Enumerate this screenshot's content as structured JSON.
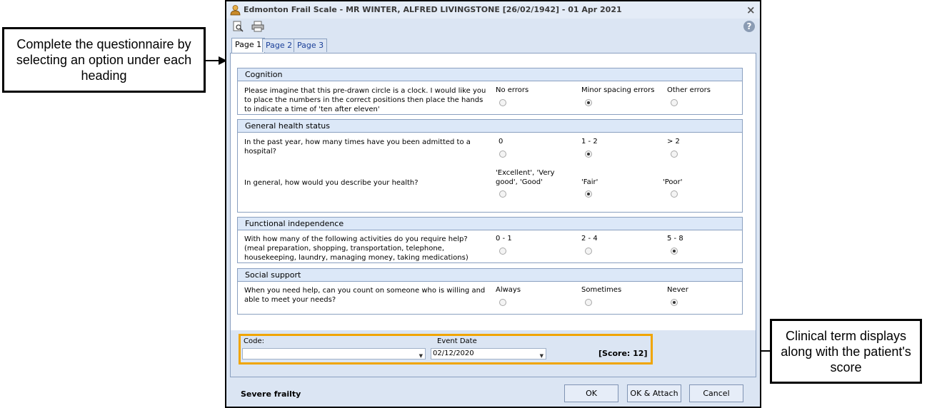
{
  "callouts": {
    "left": "Complete the questionnaire by selecting an option under each heading",
    "right": "Clinical term displays along with the patient's score"
  },
  "window": {
    "title": "Edmonton Frail Scale - MR WINTER, ALFRED LIVINGSTONE [26/02/1942] - 01 Apr 2021",
    "close": "×",
    "help": "?"
  },
  "tabs": [
    "Page 1",
    "Page 2",
    "Page 3"
  ],
  "sections": {
    "cognition": {
      "heading": "Cognition",
      "q1": "Please imagine that this pre-drawn circle is a clock. I would like you to place the numbers in the correct positions then place the hands to indicate a time of 'ten after eleven'",
      "options": [
        "No errors",
        "Minor spacing errors",
        "Other errors"
      ],
      "selected": 1
    },
    "general_health": {
      "heading": "General health status",
      "q1": "In the past year, how many times have you been admitted to a hospital?",
      "q1_options": [
        "0",
        "1 - 2",
        "> 2"
      ],
      "q1_selected": 1,
      "q2": "In general, how would you describe your health?",
      "q2_options": [
        "'Excellent', 'Very good', 'Good'",
        "'Fair'",
        "'Poor'"
      ],
      "q2_selected": 1
    },
    "functional": {
      "heading": "Functional independence",
      "q1": "With how many of the following activities do you require help? (meal preparation, shopping, transportation, telephone, housekeeping, laundry, managing money, taking medications)",
      "options": [
        "0 - 1",
        "2 - 4",
        "5 - 8"
      ],
      "selected": 2
    },
    "social": {
      "heading": "Social support",
      "q1": "When you need help, can you count on someone who is willing and able to meet your needs?",
      "options": [
        "Always",
        "Sometimes",
        "Never"
      ],
      "selected": 2
    }
  },
  "footer": {
    "code_label": "Code:",
    "code_value": "",
    "event_date_label": "Event Date",
    "event_date_value": "02/12/2020",
    "score": "[Score: 12]",
    "status": "Severe frailty",
    "ok": "OK",
    "ok_attach": "OK & Attach",
    "cancel": "Cancel"
  },
  "icons": [
    "user-icon",
    "preview-icon",
    "print-icon",
    "help-icon",
    "close-icon"
  ]
}
